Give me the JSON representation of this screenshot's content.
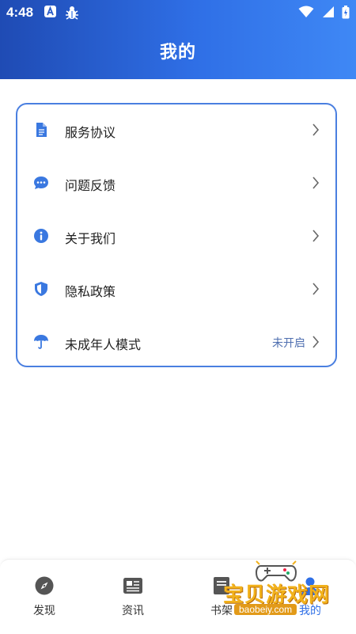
{
  "status_bar": {
    "time": "4:48"
  },
  "header": {
    "title": "我的"
  },
  "menu": {
    "items": [
      {
        "label": "服务协议",
        "icon": "document-icon",
        "value": ""
      },
      {
        "label": "问题反馈",
        "icon": "chat-bubble-icon",
        "value": ""
      },
      {
        "label": "关于我们",
        "icon": "info-icon",
        "value": ""
      },
      {
        "label": "隐私政策",
        "icon": "shield-icon",
        "value": ""
      },
      {
        "label": "未成年人模式",
        "icon": "umbrella-icon",
        "value": "未开启"
      }
    ]
  },
  "tabbar": {
    "tabs": [
      {
        "label": "发现",
        "icon": "compass-icon"
      },
      {
        "label": "资讯",
        "icon": "news-icon"
      },
      {
        "label": "书架",
        "icon": "bookshelf-icon"
      },
      {
        "label": "我的",
        "icon": "user-icon"
      }
    ],
    "active": "我的"
  },
  "watermark": {
    "text": "宝贝游戏网",
    "url": "baobeiy.com"
  },
  "colors": {
    "accent": "#2f6fe6",
    "header_start": "#1f4bb4",
    "header_end": "#3f88f5"
  }
}
